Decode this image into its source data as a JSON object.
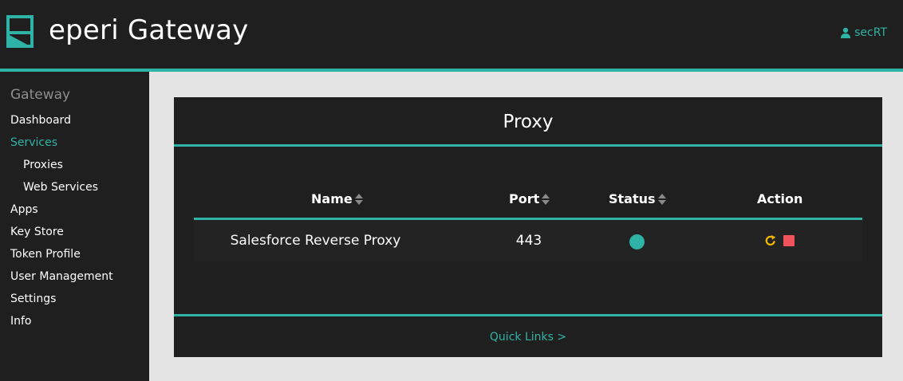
{
  "header": {
    "app_title": "eperi Gateway",
    "user_name": "secRT",
    "logo_icon": "eperi-logo-icon",
    "user_icon": "user-icon"
  },
  "sidebar": {
    "heading": "Gateway",
    "items": [
      {
        "label": "Dashboard",
        "level": 0,
        "active": false
      },
      {
        "label": "Services",
        "level": 0,
        "active": true
      },
      {
        "label": "Proxies",
        "level": 1,
        "active": false
      },
      {
        "label": "Web Services",
        "level": 1,
        "active": false
      },
      {
        "label": "Apps",
        "level": 0,
        "active": false
      },
      {
        "label": "Key Store",
        "level": 0,
        "active": false
      },
      {
        "label": "Token Profile",
        "level": 0,
        "active": false
      },
      {
        "label": "User Management",
        "level": 0,
        "active": false
      },
      {
        "label": "Settings",
        "level": 0,
        "active": false
      },
      {
        "label": "Info",
        "level": 0,
        "active": false
      }
    ]
  },
  "panel": {
    "title": "Proxy",
    "table": {
      "columns": [
        {
          "label": "Name",
          "sortable": true
        },
        {
          "label": "Port",
          "sortable": true
        },
        {
          "label": "Status",
          "sortable": true
        },
        {
          "label": "Action",
          "sortable": false
        }
      ],
      "rows": [
        {
          "name": "Salesforce Reverse Proxy",
          "port": "443",
          "status": "running",
          "actions": [
            "restart-icon",
            "stop-icon"
          ]
        }
      ]
    },
    "quick_links": "Quick Links >"
  },
  "colors": {
    "accent": "#2fb3a6",
    "background_dark": "#1f1f1f",
    "content_background": "#e4e4e4",
    "restart_icon": "#f5b800",
    "stop_icon": "#f0535a",
    "sidebar_heading": "#8e8e8e"
  }
}
